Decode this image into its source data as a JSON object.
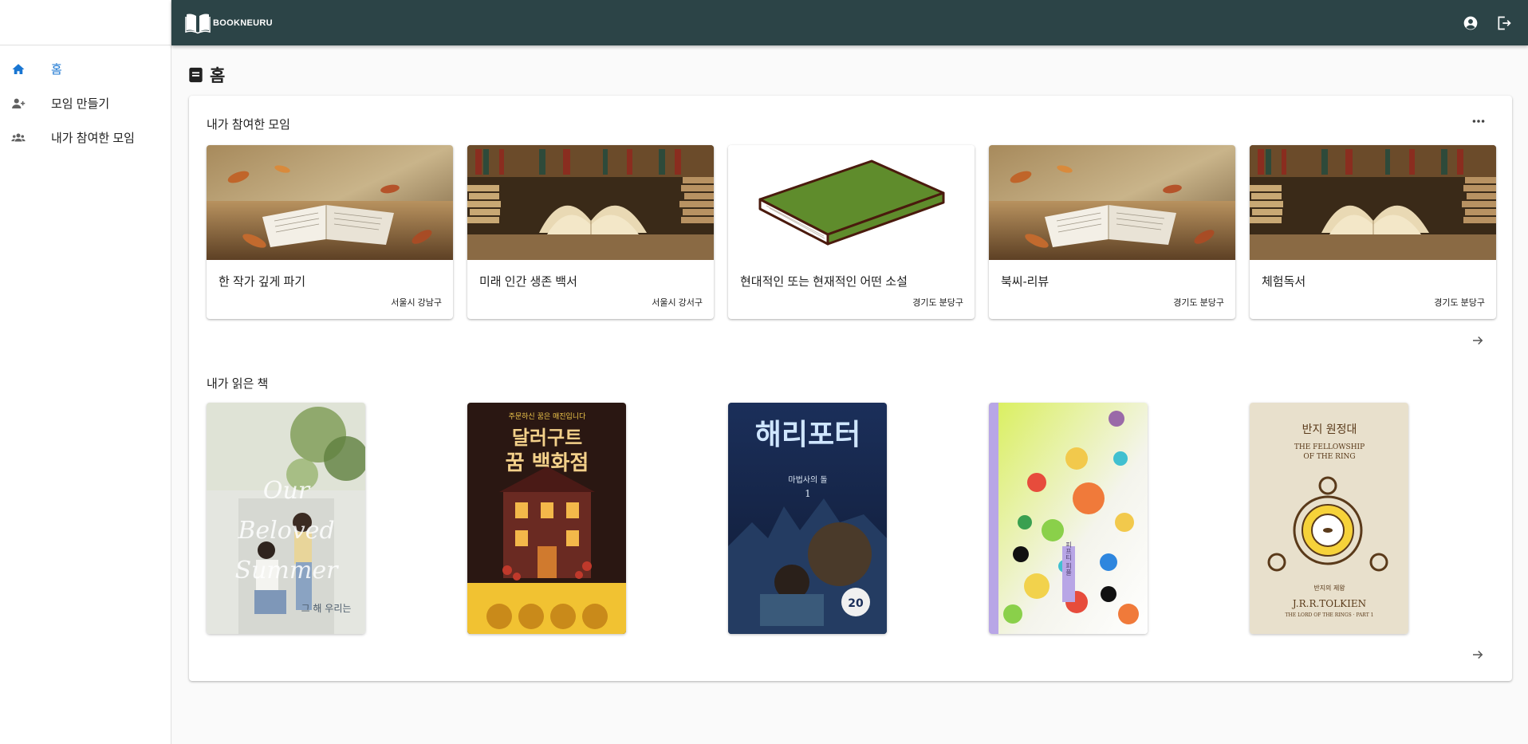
{
  "app": {
    "brand": "BOOKNEURU"
  },
  "sidebar": {
    "items": [
      {
        "label": "홈",
        "icon": "home-icon",
        "active": true
      },
      {
        "label": "모임 만들기",
        "icon": "user-plus-icon",
        "active": false
      },
      {
        "label": "내가 참여한 모임",
        "icon": "users-icon",
        "active": false
      }
    ]
  },
  "header": {
    "profile_icon": "account-circle-icon",
    "logout_icon": "logout-icon"
  },
  "page": {
    "title": "홈"
  },
  "groups_section": {
    "title": "내가 참여한 모임",
    "items": [
      {
        "name": "한 작가 깊게 파기",
        "location": "서울시 강남구",
        "image": "open-book-autumn-leaves"
      },
      {
        "name": "미래 인간 생존 백서",
        "location": "서울시 강서구",
        "image": "open-book-library-stacks"
      },
      {
        "name": "현대적인 또는 현재적인 어떤 소설",
        "location": "경기도 분당구",
        "image": "green-book-illustration"
      },
      {
        "name": "북씨-리뷰",
        "location": "경기도 분당구",
        "image": "open-book-autumn-leaves"
      },
      {
        "name": "체험독서",
        "location": "경기도 분당구",
        "image": "open-book-library-stacks"
      }
    ]
  },
  "books_section": {
    "title": "내가 읽은 책",
    "items": [
      {
        "cover_text": "Our Beloved Summer",
        "subtitle": "그 해 우리는"
      },
      {
        "cover_text": "달러구트 꿈 백화점",
        "subtitle": "주문하신 꿈은 매진입니다"
      },
      {
        "cover_text": "해리포터",
        "subtitle": "마법사의 돌 1"
      },
      {
        "cover_text": "피프티 피플",
        "subtitle": ""
      },
      {
        "cover_text": "반지 원정대",
        "subtitle": "THE FELLOWSHIP OF THE RING",
        "author": "J.R.R.TOLKIEN"
      }
    ]
  },
  "colors": {
    "appbar": "#2c4447",
    "accent": "#1976d2",
    "background": "#fafafa"
  }
}
